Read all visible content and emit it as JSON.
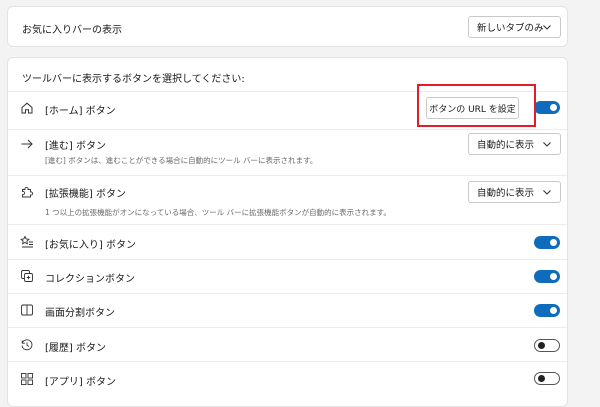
{
  "favorites_bar": {
    "label": "お気に入りバーの表示",
    "select_value": "新しいタブのみ"
  },
  "toolbar_section": {
    "heading": "ツールバーに表示するボタンを選択してください:",
    "home": {
      "label": "[ホーム] ボタン",
      "set_url_button": "ボタンの URL を設定",
      "toggle_state": "on"
    },
    "forward": {
      "label": "[進む] ボタン",
      "description": "[進む] ボタンは、進むことができる場合に自動的にツール バーに表示されます。",
      "select_value": "自動的に表示"
    },
    "extensions": {
      "label": "[拡張機能] ボタン",
      "description": "1 つ以上の拡張機能がオンになっている場合、ツール バーに拡張機能ボタンが自動的に表示されます。",
      "select_value": "自動的に表示"
    },
    "favorites": {
      "label": "[お気に入り] ボタン",
      "toggle_state": "on"
    },
    "collections": {
      "label": "コレクションボタン",
      "toggle_state": "on"
    },
    "split_screen": {
      "label": "画面分割ボタン",
      "toggle_state": "on"
    },
    "history": {
      "label": "[履歴] ボタン",
      "toggle_state": "off"
    },
    "apps": {
      "label": "[アプリ] ボタン",
      "toggle_state": "off"
    }
  },
  "colors": {
    "accent": "#0f6cbd",
    "highlight": "#e01e2b",
    "background": "#f3f3f3"
  },
  "icons": [
    "chevron-down-icon",
    "home-icon",
    "arrow-right-icon",
    "puzzle-icon",
    "star-list-icon",
    "collections-icon",
    "split-screen-icon",
    "history-icon",
    "apps-icon"
  ]
}
